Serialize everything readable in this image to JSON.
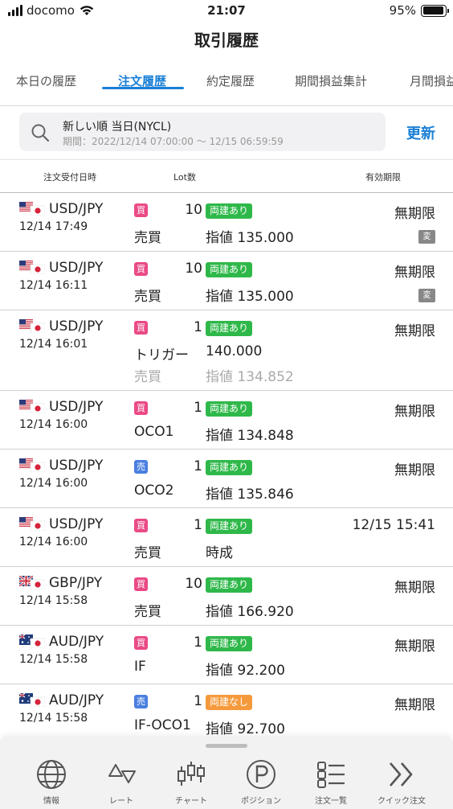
{
  "status_bar": {
    "carrier": "docomo",
    "time": "21:07",
    "battery": "95%",
    "battery_level": 0.95
  },
  "title": "取引履歴",
  "tabs": [
    {
      "label": "本日の履歴"
    },
    {
      "label": "注文履歴",
      "active": true
    },
    {
      "label": "約定履歴"
    },
    {
      "label": "期間損益集計"
    },
    {
      "label": "月間損益"
    }
  ],
  "filter": {
    "sort_label": "新しい順 当日(NYCL)",
    "period": "期間：2022/12/14 07:00:00 ～ 12/15 06:59:59",
    "refresh_label": "更新"
  },
  "columns": {
    "order_time": "注文受付日時",
    "lot": "Lot数",
    "expiry": "有効期限"
  },
  "orders": [
    {
      "flag": "us",
      "pair": "USD/JPY",
      "datetime": "12/14 17:49",
      "side": "買",
      "side_type": "buy",
      "lot": "10",
      "tag": "両建あり",
      "tag_type": "yes",
      "expiry": "無期限",
      "change_badge": "変",
      "type": "売買",
      "price": "指値 135.000"
    },
    {
      "flag": "us",
      "pair": "USD/JPY",
      "datetime": "12/14 16:11",
      "side": "買",
      "side_type": "buy",
      "lot": "10",
      "tag": "両建あり",
      "tag_type": "yes",
      "expiry": "無期限",
      "change_badge": "変",
      "type": "売買",
      "price": "指値 135.000"
    },
    {
      "flag": "us",
      "pair": "USD/JPY",
      "datetime": "12/14 16:01",
      "side": "買",
      "side_type": "buy",
      "lot": "1",
      "tag": "両建あり",
      "tag_type": "yes",
      "expiry": "無期限",
      "type": "トリガー",
      "price": "140.000",
      "type2": "売買",
      "price2": "指値 134.852"
    },
    {
      "flag": "us",
      "pair": "USD/JPY",
      "datetime": "12/14 16:00",
      "side": "買",
      "side_type": "buy",
      "lot": "1",
      "tag": "両建あり",
      "tag_type": "yes",
      "expiry": "無期限",
      "type": "OCO1",
      "price": "指値 134.848"
    },
    {
      "flag": "us",
      "pair": "USD/JPY",
      "datetime": "12/14 16:00",
      "side": "売",
      "side_type": "sell",
      "lot": "1",
      "tag": "両建あり",
      "tag_type": "yes",
      "expiry": "無期限",
      "type": "OCO2",
      "price": "指値 135.846"
    },
    {
      "flag": "us",
      "pair": "USD/JPY",
      "datetime": "12/14 16:00",
      "side": "買",
      "side_type": "buy",
      "lot": "1",
      "tag": "両建あり",
      "tag_type": "yes",
      "expiry": "12/15 15:41",
      "type": "売買",
      "price": "時成"
    },
    {
      "flag": "gb",
      "pair": "GBP/JPY",
      "datetime": "12/14 15:58",
      "side": "買",
      "side_type": "buy",
      "lot": "10",
      "tag": "両建あり",
      "tag_type": "yes",
      "expiry": "無期限",
      "type": "売買",
      "price": "指値 166.920"
    },
    {
      "flag": "au",
      "pair": "AUD/JPY",
      "datetime": "12/14 15:58",
      "side": "買",
      "side_type": "buy",
      "lot": "1",
      "tag": "両建あり",
      "tag_type": "yes",
      "expiry": "無期限",
      "type": "IF",
      "price": "指値 92.200"
    },
    {
      "flag": "au",
      "pair": "AUD/JPY",
      "datetime": "12/14 15:58",
      "side": "売",
      "side_type": "sell",
      "lot": "1",
      "tag": "両建なし",
      "tag_type": "no",
      "expiry": "無期限",
      "type": "IF-OCO1",
      "price": "指値 92.700"
    }
  ],
  "bottom_nav": [
    {
      "label": "情報",
      "icon": "globe-icon"
    },
    {
      "label": "レート",
      "icon": "rate-arrows-icon"
    },
    {
      "label": "チャート",
      "icon": "candlestick-icon"
    },
    {
      "label": "ポジション",
      "icon": "position-p-icon"
    },
    {
      "label": "注文一覧",
      "icon": "order-list-icon"
    },
    {
      "label": "クイック注文",
      "icon": "double-chevron-icon"
    }
  ],
  "colors": {
    "accent": "#1a7fd6",
    "buy": "#ea4a86",
    "sell": "#4a7fe0",
    "hedge_yes": "#2fb84a",
    "hedge_no": "#f59a3c"
  }
}
